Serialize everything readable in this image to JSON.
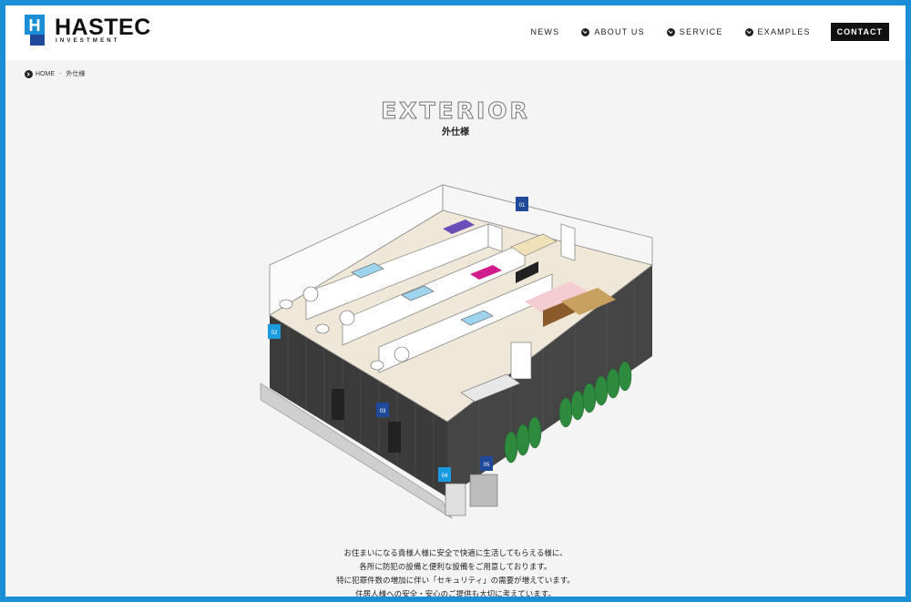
{
  "header": {
    "logo_text": "HASTEC",
    "logo_sub": "INVESTMENT",
    "logo_mark": "H",
    "nav": [
      {
        "label": "NEWS",
        "icon": ""
      },
      {
        "label": "ABOUT US",
        "icon": "check-circle-icon"
      },
      {
        "label": "SERVICE",
        "icon": "check-circle-icon"
      },
      {
        "label": "EXAMPLES",
        "icon": "check-circle-icon"
      }
    ],
    "contact_label": "CONTACT"
  },
  "breadcrumb": {
    "home": "HOME",
    "separator": "-",
    "current": "外仕様"
  },
  "page": {
    "title_en": "EXTERIOR",
    "title_ja": "外仕様"
  },
  "pins": [
    "01",
    "02",
    "03",
    "04",
    "05"
  ],
  "intro": [
    "お住まいになる貴様人様に安全で快適に生活してもらえる様に、",
    "各所に防犯の設備と便利な設備をご用意しております。",
    "特に犯罪件数の増加に伴い「セキュリティ」の需要が増えています。",
    "住居人様への安全・安心のご提供も大切に考えています。"
  ],
  "colors": {
    "accent": "#1a8fd6",
    "pin": "#1f4a99",
    "pin_light": "#1a9be0",
    "wall": "#3a3a3a",
    "tree": "#2e8b3e"
  }
}
